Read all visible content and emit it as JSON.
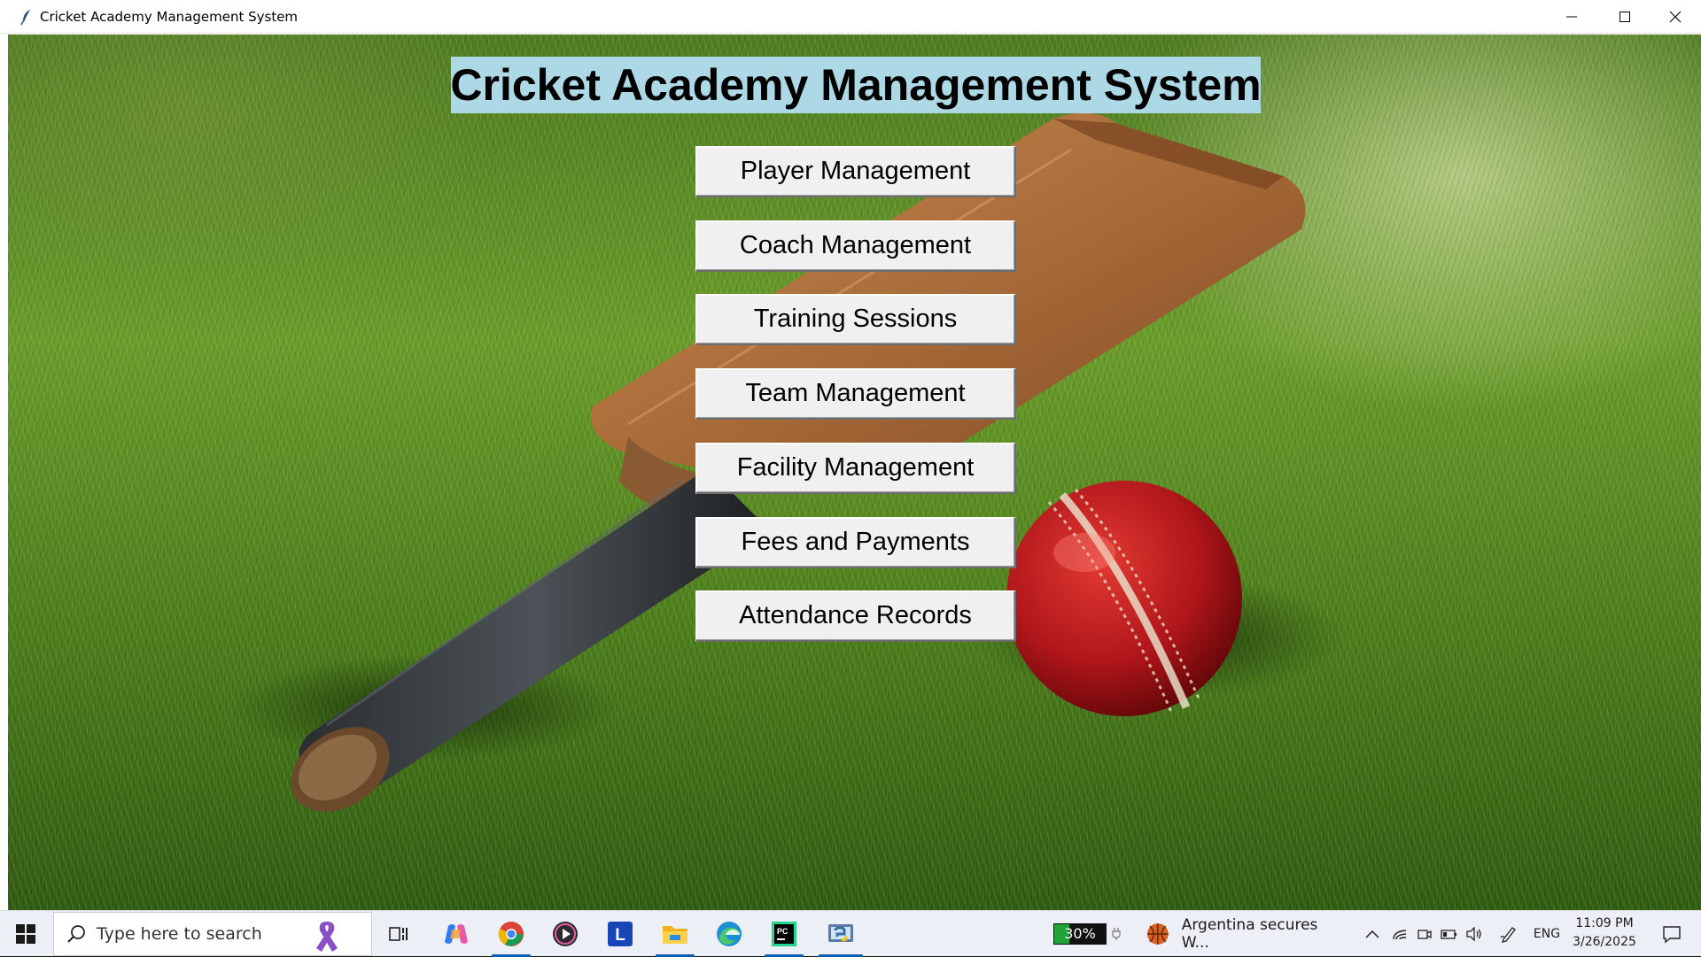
{
  "window": {
    "title": "Cricket Academy Management System"
  },
  "app": {
    "heading": "Cricket Academy Management System",
    "heading_bg": "#add8e6",
    "menu": [
      {
        "label": "Player Management"
      },
      {
        "label": "Coach Management"
      },
      {
        "label": "Training Sessions"
      },
      {
        "label": "Team Management"
      },
      {
        "label": "Facility Management"
      },
      {
        "label": "Fees and Payments"
      },
      {
        "label": "Attendance Records"
      }
    ]
  },
  "taskbar": {
    "search_placeholder": "Type here to search",
    "battery_percent": "30%",
    "news_text": "Argentina secures W...",
    "language": "ENG",
    "time": "11:09 PM",
    "date": "3/26/2025",
    "pinned_icons": [
      "task-view-icon",
      "copilot-icon",
      "chrome-icon",
      "media-player-icon",
      "l-app-icon",
      "file-explorer-icon",
      "edge-icon",
      "pycharm-icon",
      "python-app-icon"
    ]
  }
}
